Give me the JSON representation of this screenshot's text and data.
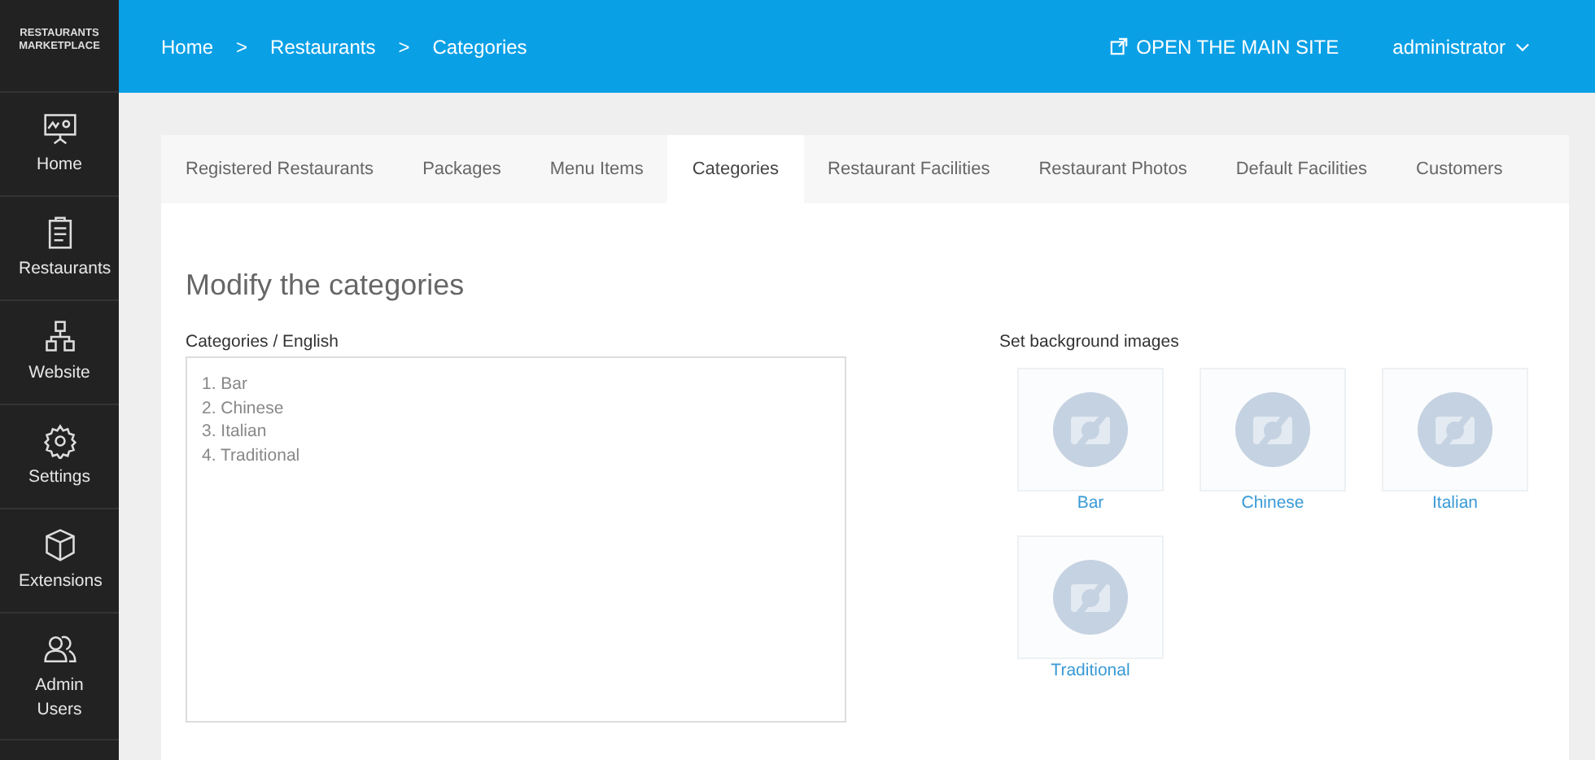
{
  "brand": "RESTAURANTS MARKETPLACE",
  "sidebar": {
    "items": [
      {
        "label": "Home",
        "selected": false
      },
      {
        "label": "Restaurants",
        "selected": false
      },
      {
        "label": "Website",
        "selected": false
      },
      {
        "label": "Settings",
        "selected": false
      },
      {
        "label": "Extensions",
        "selected": false
      },
      {
        "label": "Admin Users",
        "selected": false
      }
    ]
  },
  "breadcrumb": [
    {
      "label": "Home"
    },
    {
      "label": ">"
    },
    {
      "label": "Restaurants"
    },
    {
      "label": ">"
    },
    {
      "label": "Categories"
    }
  ],
  "open_site": "OPEN THE MAIN SITE",
  "user": "administrator",
  "tabs": [
    {
      "label": "Registered Restaurants",
      "selected": false
    },
    {
      "label": "Packages",
      "selected": false
    },
    {
      "label": "Menu Items",
      "selected": false
    },
    {
      "label": "Categories",
      "selected": true
    },
    {
      "label": "Restaurant Facilities",
      "selected": false
    },
    {
      "label": "Restaurant Photos",
      "selected": false
    },
    {
      "label": "Default Facilities",
      "selected": false
    },
    {
      "label": "Customers",
      "selected": false
    }
  ],
  "heading": "Modify the categories",
  "categories_field": {
    "label": "Categories / English",
    "lines": [
      "1. Bar",
      "2. Chinese",
      "3. Italian",
      "4. Traditional"
    ]
  },
  "backgrounds": {
    "label": "Set background images",
    "images": [
      {
        "label": "Bar"
      },
      {
        "label": "Chinese"
      },
      {
        "label": "Italian"
      },
      {
        "label": "Traditional"
      }
    ]
  }
}
